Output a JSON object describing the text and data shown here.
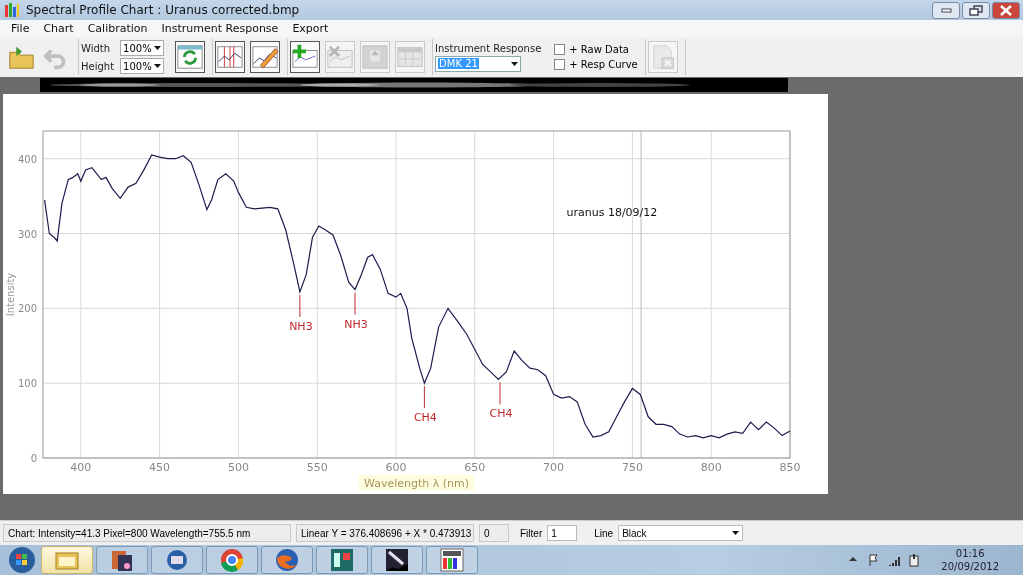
{
  "window": {
    "title": "Spectral Profile Chart : Uranus corrected.bmp",
    "controls": [
      {
        "kind": "minimize"
      },
      {
        "kind": "restore"
      },
      {
        "kind": "close"
      }
    ]
  },
  "menu": [
    "File",
    "Chart",
    "Calibration",
    "Instrument Response",
    "Export"
  ],
  "toolbar": {
    "groups": [
      [
        {
          "kind": "open",
          "disabled": false
        },
        {
          "kind": "undo",
          "disabled": true
        }
      ],
      [
        {
          "kind": "size"
        },
        {
          "kind": "refresh",
          "disabled": false
        }
      ],
      [
        {
          "kind": "markers",
          "disabled": false
        },
        {
          "kind": "edit",
          "disabled": false
        }
      ],
      [
        {
          "kind": "add",
          "disabled": false
        },
        {
          "kind": "remove",
          "disabled": true
        },
        {
          "kind": "move",
          "disabled": true
        },
        {
          "kind": "table",
          "disabled": true
        }
      ],
      [
        {
          "kind": "response"
        }
      ],
      [
        {
          "kind": "close-doc",
          "disabled": true
        }
      ]
    ],
    "width": {
      "label": "Width",
      "value": "100%"
    },
    "height": {
      "label": "Height",
      "value": "100%"
    },
    "response": {
      "label": "Instrument  Response",
      "value": "DMK 21"
    },
    "checkboxes": [
      {
        "label": "+ Raw Data",
        "checked": false
      },
      {
        "label": "+ Resp Curve",
        "checked": false
      }
    ]
  },
  "chart": {
    "kind": "plot",
    "chart_data": {
      "type": "line",
      "grid": true,
      "xlabel": "Wavelength λ (nm)",
      "ylabel": "Intensity",
      "xlim": [
        376,
        850
      ],
      "ylim": [
        0,
        437
      ],
      "xticks": [
        400,
        450,
        500,
        550,
        600,
        650,
        700,
        750,
        800,
        850
      ],
      "yticks": [
        0,
        100,
        200,
        300,
        400
      ],
      "x": [
        377,
        380,
        383,
        385,
        388,
        392,
        395,
        398,
        400,
        403,
        407,
        410,
        413,
        416,
        420,
        425,
        430,
        435,
        440,
        445,
        450,
        455,
        460,
        465,
        470,
        475,
        480,
        483,
        487,
        492,
        497,
        500,
        505,
        510,
        515,
        520,
        525,
        530,
        535,
        539,
        543,
        547,
        551,
        555,
        560,
        565,
        570,
        574,
        578,
        582,
        585,
        590,
        595,
        600,
        603,
        607,
        610,
        615,
        618,
        622,
        627,
        633,
        640,
        645,
        650,
        655,
        660,
        665,
        670,
        675,
        680,
        685,
        690,
        695,
        700,
        705,
        710,
        715,
        720,
        725,
        730,
        735,
        740,
        745,
        750,
        755,
        760,
        765,
        770,
        775,
        780,
        785,
        790,
        795,
        800,
        805,
        810,
        815,
        820,
        825,
        830,
        835,
        840,
        845,
        850
      ],
      "series": [
        {
          "name": "uranus 18/09/12",
          "color": "#1c1c4e",
          "values": [
            345,
            300,
            295,
            290,
            340,
            372,
            375,
            380,
            370,
            385,
            388,
            380,
            372,
            375,
            360,
            347,
            362,
            367,
            385,
            405,
            402,
            400,
            400,
            404,
            395,
            365,
            332,
            345,
            372,
            380,
            370,
            355,
            335,
            333,
            334,
            335,
            333,
            305,
            260,
            222,
            245,
            295,
            310,
            305,
            298,
            270,
            235,
            225,
            245,
            268,
            272,
            252,
            220,
            215,
            220,
            200,
            160,
            120,
            100,
            120,
            175,
            200,
            180,
            165,
            145,
            125,
            115,
            105,
            115,
            143,
            130,
            120,
            118,
            110,
            85,
            80,
            82,
            75,
            45,
            28,
            30,
            35,
            55,
            75,
            93,
            85,
            55,
            45,
            45,
            42,
            32,
            28,
            30,
            27,
            30,
            27,
            32,
            35,
            33,
            48,
            38,
            48,
            40,
            30,
            36
          ]
        }
      ],
      "annotations": [
        {
          "x": 539,
          "y": 222,
          "text": "NH3"
        },
        {
          "x": 574,
          "y": 225,
          "text": "NH3"
        },
        {
          "x": 618,
          "y": 100,
          "text": "CH4"
        },
        {
          "x": 666,
          "y": 105,
          "text": "CH4"
        }
      ],
      "ref_lines": [
        {
          "axis": "x",
          "value": 755.5
        }
      ]
    }
  },
  "status_bar": {
    "readout": "Chart: Intensity=41.3  Pixel=800  Wavelength=755.5 nm",
    "fit": "Linear Y = 376.408696  +  X * 0.473913",
    "count": "0",
    "filter_label": "Filter",
    "filter_value": "1",
    "line_label": "Line",
    "line_value": "Black"
  },
  "taskbar": {
    "apps": [
      {
        "kind": "folder",
        "highlighted": true
      },
      {
        "kind": "media",
        "highlighted": false
      },
      {
        "kind": "mail",
        "highlighted": false
      },
      {
        "kind": "browser-round",
        "highlighted": false
      },
      {
        "kind": "browser-fox",
        "highlighted": false
      },
      {
        "kind": "rs",
        "highlighted": false
      },
      {
        "kind": "comet",
        "highlighted": false
      },
      {
        "kind": "bass",
        "highlighted": false
      }
    ],
    "tray": [
      {
        "kind": "arrow"
      },
      {
        "kind": "flag"
      },
      {
        "kind": "signal"
      },
      {
        "kind": "power"
      }
    ],
    "time": "01:16",
    "date": "20/09/2012"
  }
}
